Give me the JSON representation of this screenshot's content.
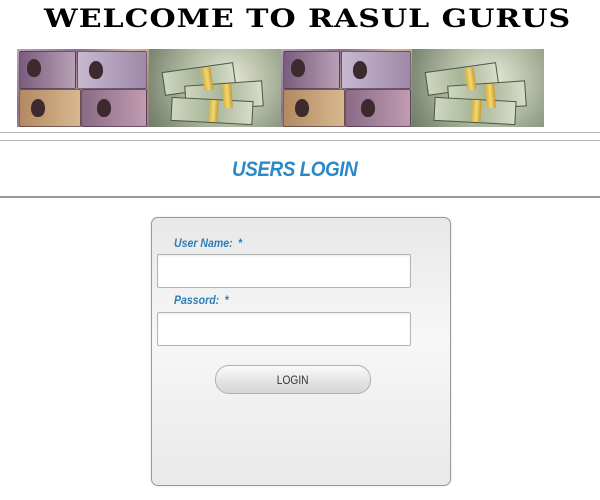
{
  "header": {
    "welcome_text": "WELCOME TO RASUL GURUS"
  },
  "login_section": {
    "title": "USERS LOGIN",
    "username_label": "User Name:",
    "password_label": "Passord:",
    "required_mark": "*",
    "username_value": "",
    "password_value": "",
    "login_button_label": "LOGIN"
  },
  "colors": {
    "accent_blue": "#2a8ac8",
    "label_blue": "#2a7fb8"
  }
}
